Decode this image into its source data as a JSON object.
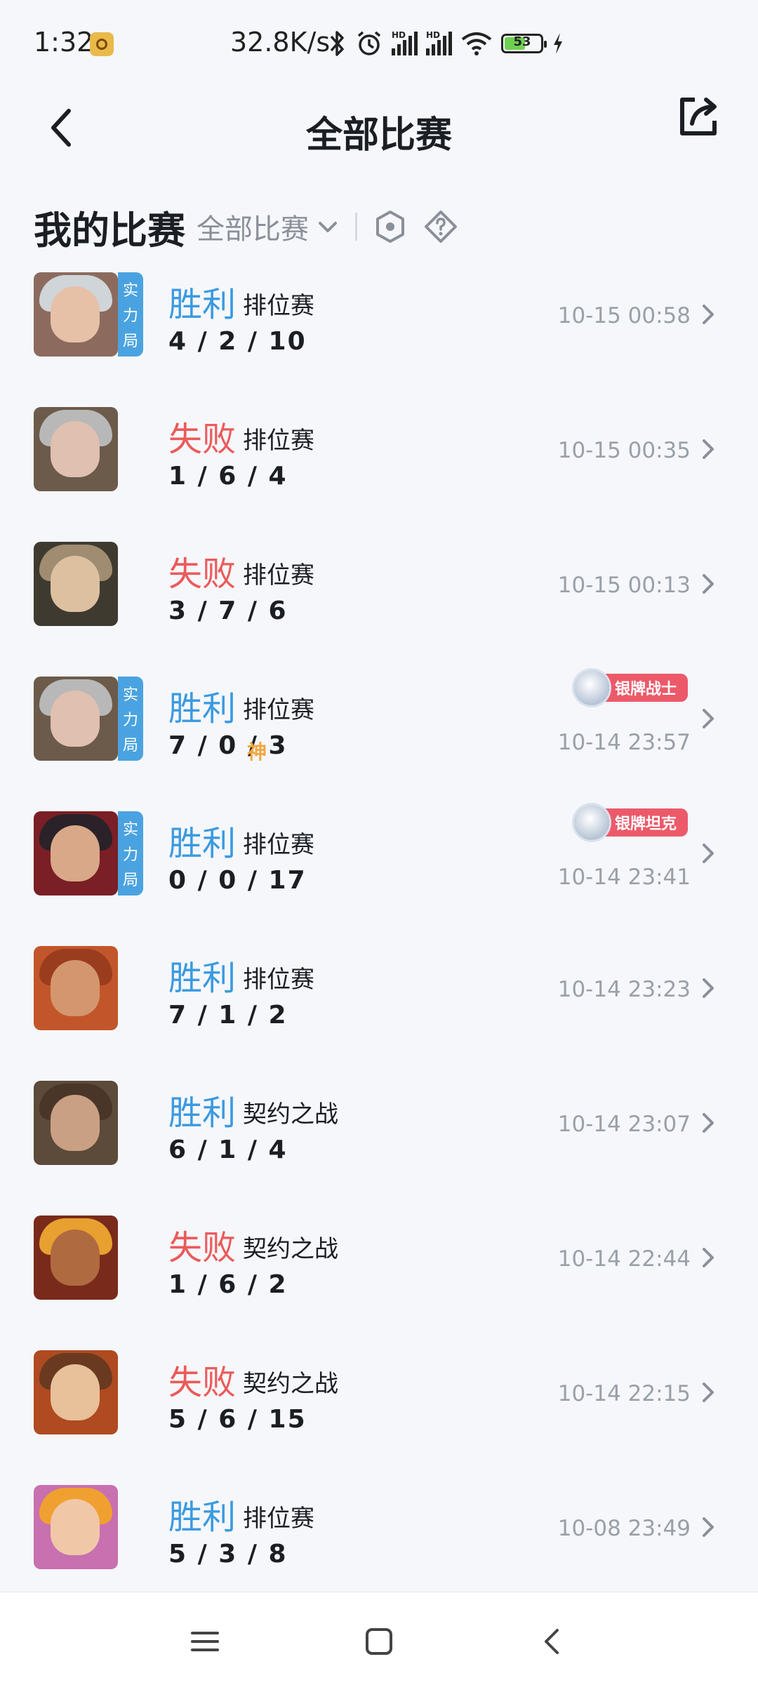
{
  "status_bar": {
    "time": "1:32",
    "net_speed": "32.8K/s",
    "hd_label": "HD",
    "battery": "53",
    "icons": [
      "app-icon",
      "bluetooth-icon",
      "alarm-icon",
      "signal-icon",
      "signal-icon",
      "wifi-icon",
      "battery-icon",
      "charging-icon"
    ]
  },
  "header": {
    "title": "全部比赛"
  },
  "section": {
    "title": "我的比赛",
    "filter": "全部比赛"
  },
  "matches": [
    {
      "result": "胜利",
      "outcome": "win",
      "mode": "排位赛",
      "kda": "4 / 2 / 10",
      "time": "10-15 00:58",
      "tag": [
        "实",
        "力",
        "局"
      ],
      "badge": null,
      "god": null,
      "face": "#e7c0a8",
      "hair": "#cfd5d8",
      "bg": "#8c6b5e"
    },
    {
      "result": "失败",
      "outcome": "lose",
      "mode": "排位赛",
      "kda": "1 / 6 / 4",
      "time": "10-15 00:35",
      "tag": null,
      "badge": null,
      "god": null,
      "face": "#e0c0b0",
      "hair": "#b8b8b8",
      "bg": "#6c5a4a"
    },
    {
      "result": "失败",
      "outcome": "lose",
      "mode": "排位赛",
      "kda": "3 / 7 / 6",
      "time": "10-15 00:13",
      "tag": null,
      "badge": null,
      "god": null,
      "face": "#dcc0a0",
      "hair": "#a08c70",
      "bg": "#3f3a30"
    },
    {
      "result": "胜利",
      "outcome": "win",
      "mode": "排位赛",
      "kda": "7 / 0 / 3",
      "time": "10-14 23:57",
      "tag": [
        "实",
        "力",
        "局"
      ],
      "badge": "银牌战士",
      "god": "神",
      "face": "#e0c0b0",
      "hair": "#b8b8b8",
      "bg": "#6c5a4a"
    },
    {
      "result": "胜利",
      "outcome": "win",
      "mode": "排位赛",
      "kda": "0 / 0 / 17",
      "time": "10-14 23:41",
      "tag": [
        "实",
        "力",
        "局"
      ],
      "badge": "银牌坦克",
      "god": null,
      "face": "#d9a888",
      "hair": "#2a2228",
      "bg": "#7a1f25"
    },
    {
      "result": "胜利",
      "outcome": "win",
      "mode": "排位赛",
      "kda": "7 / 1 / 2",
      "time": "10-14 23:23",
      "tag": null,
      "badge": null,
      "god": null,
      "face": "#d4966e",
      "hair": "#9a3d1e",
      "bg": "#c2562a"
    },
    {
      "result": "胜利",
      "outcome": "win",
      "mode": "契约之战",
      "kda": "6 / 1 / 4",
      "time": "10-14 23:07",
      "tag": null,
      "badge": null,
      "god": null,
      "face": "#c9a084",
      "hair": "#4a3628",
      "bg": "#5c4a3a"
    },
    {
      "result": "失败",
      "outcome": "lose",
      "mode": "契约之战",
      "kda": "1 / 6 / 2",
      "time": "10-14 22:44",
      "tag": null,
      "badge": null,
      "god": null,
      "face": "#b06a40",
      "hair": "#e8a030",
      "bg": "#7a2a1a"
    },
    {
      "result": "失败",
      "outcome": "lose",
      "mode": "契约之战",
      "kda": "5 / 6 / 15",
      "time": "10-14 22:15",
      "tag": null,
      "badge": null,
      "god": null,
      "face": "#e8c09a",
      "hair": "#6a3a20",
      "bg": "#b04a20"
    },
    {
      "result": "胜利",
      "outcome": "win",
      "mode": "排位赛",
      "kda": "5 / 3 / 8",
      "time": "10-08 23:49",
      "tag": null,
      "badge": null,
      "god": null,
      "face": "#f0c8a8",
      "hair": "#f0a030",
      "bg": "#c870b0"
    }
  ],
  "colors": {
    "win": "#3b9ae0",
    "lose": "#ec5a5a",
    "tag_bg": "#4aa3e0",
    "badge_bg": "#ec5a6a",
    "page_bg": "#f5f7fb"
  },
  "nav_bar": {
    "icons": [
      "menu-icon",
      "home-icon",
      "back-icon"
    ]
  }
}
